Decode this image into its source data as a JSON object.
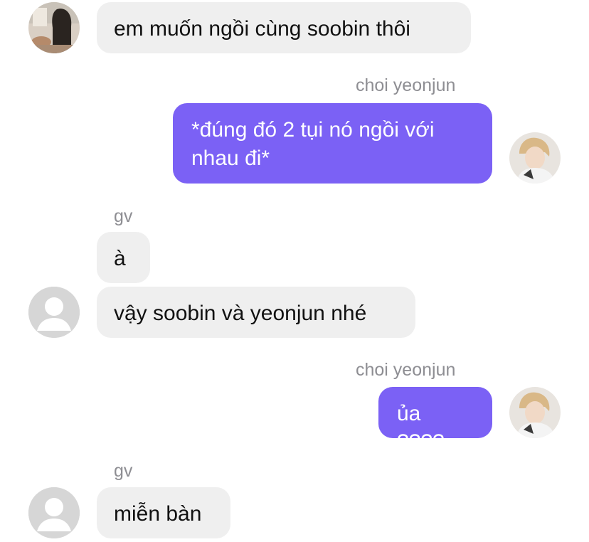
{
  "colors": {
    "incoming_bubble": "#efefef",
    "outgoing_bubble": "#7b61f5",
    "sender_name": "#8e8e93",
    "default_avatar_bg": "#d6d6d6"
  },
  "messages": [
    {
      "direction": "incoming",
      "sender": "",
      "avatar": "photo-avatar-girl",
      "text": "em muốn ngồi cùng soobin thôi"
    },
    {
      "direction": "outgoing",
      "sender": "choi yeonjun",
      "avatar": "photo-avatar-yeonjun",
      "text_line1": "*đúng đó 2 tụi nó ngồi với",
      "text_line2": "nhau đi*"
    },
    {
      "direction": "incoming",
      "sender": "gv",
      "avatar": "",
      "text": "à"
    },
    {
      "direction": "incoming",
      "sender": "",
      "avatar": "default-user-icon",
      "text": "vậy soobin và yeonjun nhé"
    },
    {
      "direction": "outgoing",
      "sender": "choi yeonjun",
      "avatar": "photo-avatar-yeonjun",
      "text": "ủa ????"
    },
    {
      "direction": "incoming",
      "sender": "gv",
      "avatar": "default-user-icon",
      "text": "miễn bàn"
    }
  ]
}
